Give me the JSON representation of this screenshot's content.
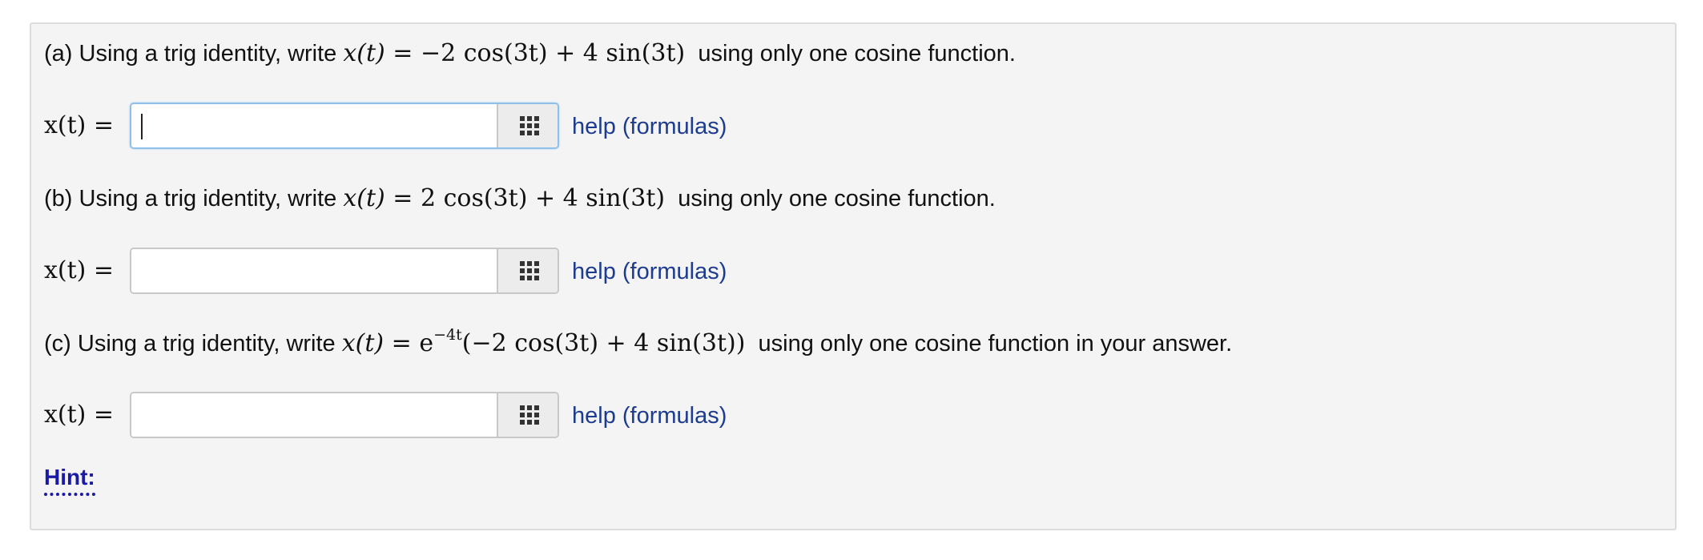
{
  "problems": [
    {
      "prefix": "(a) Using a trig identity, write ",
      "math_lhs": "x(t)",
      "math_rhs": " = −2 cos(3t) + 4 sin(3t)",
      "suffix": "  using only one cosine function.",
      "answer_label": "x(t) =",
      "answer_value": "",
      "answer_focused": true,
      "help_label": "help (formulas)"
    },
    {
      "prefix": "(b) Using a trig identity, write ",
      "math_lhs": "x(t)",
      "math_rhs": " = 2 cos(3t) + 4 sin(3t)",
      "suffix": "  using only one cosine function.",
      "answer_label": "x(t) =",
      "answer_value": "",
      "answer_focused": false,
      "help_label": "help (formulas)"
    },
    {
      "prefix": "(c) Using a trig identity, write ",
      "math_lhs": "x(t)",
      "math_rhs_pre": " = e",
      "math_rhs_sup": "−4t",
      "math_rhs_post": "(−2 cos(3t) + 4 sin(3t))",
      "suffix": "  using only one cosine function in your answer.",
      "answer_label": "x(t) =",
      "answer_value": "",
      "answer_focused": false,
      "help_label": "help (formulas)"
    }
  ],
  "hint_label": "Hint:",
  "icons": {
    "palette": "grid-icon"
  },
  "colors": {
    "panel_bg": "#f4f4f4",
    "link": "#1d3c8f",
    "hint": "#1a1aa6",
    "focus_border": "#8fc0ea"
  }
}
